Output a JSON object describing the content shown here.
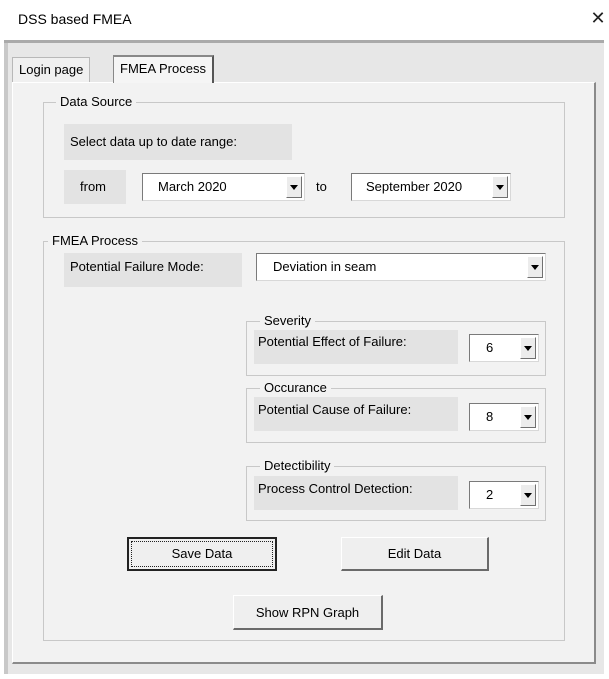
{
  "window": {
    "title": "DSS based FMEA",
    "close_glyph": "✕"
  },
  "tabs": [
    {
      "label": "Login page",
      "active": false
    },
    {
      "label": "FMEA Process",
      "active": true
    }
  ],
  "data_source": {
    "legend": "Data Source",
    "prompt": "Select data up to date range:",
    "from_label": "from",
    "from_value": "March 2020",
    "to_label": "to",
    "to_value": "September 2020"
  },
  "fmea": {
    "legend": "FMEA Process",
    "failure_mode_label": "Potential Failure Mode:",
    "failure_mode_value": "Deviation in seam",
    "severity": {
      "legend": "Severity",
      "label": "Potential Effect of Failure:",
      "value": "6"
    },
    "occurrence": {
      "legend": "Occurance",
      "label": "Potential Cause of Failure:",
      "value": "8"
    },
    "detectability": {
      "legend": "Detectibility",
      "label": "Process Control Detection:",
      "value": "2"
    }
  },
  "buttons": {
    "save": "Save Data",
    "edit": "Edit Data",
    "graph": "Show RPN Graph"
  },
  "icons": {
    "dropdown": "chevron-down-icon",
    "close": "close-icon"
  }
}
